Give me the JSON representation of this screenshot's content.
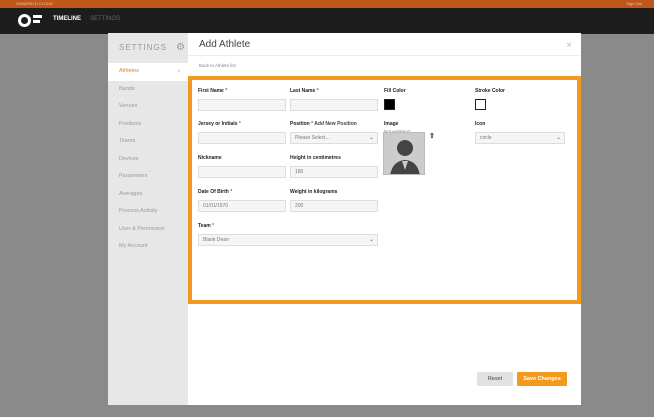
{
  "topbar": {
    "left_text": "OMNIFIELD CLOUD",
    "right_text": "Sign Out"
  },
  "nav": {
    "title": "TIMELINE",
    "second": "SETTINGS"
  },
  "sidebar": {
    "heading": "SETTINGS",
    "items": [
      {
        "label": "Athletes",
        "active": true
      },
      {
        "label": "Bands"
      },
      {
        "label": "Venues"
      },
      {
        "label": "Positions"
      },
      {
        "label": "Teams"
      },
      {
        "label": "Devices"
      },
      {
        "label": "Parameters"
      },
      {
        "label": "Averages"
      },
      {
        "label": "Process Activity"
      },
      {
        "label": "User & Permission"
      },
      {
        "label": "My Account"
      }
    ]
  },
  "dialog": {
    "title": "Add Athlete",
    "close": "×",
    "back_link": "Back to Athlete list"
  },
  "form": {
    "first_name": {
      "label": "First Name",
      "value": ""
    },
    "last_name": {
      "label": "Last Name",
      "value": ""
    },
    "fill_color": {
      "label": "Fill Color",
      "color": "#000000"
    },
    "stroke_color": {
      "label": "Stroke Color",
      "color": "#ffffff"
    },
    "jersey": {
      "label": "Jersey or Initials",
      "value": ""
    },
    "position": {
      "label": "Position",
      "add_link": "Add New Position",
      "value": "Please Select..."
    },
    "image": {
      "label": "Image",
      "note": "Not working?"
    },
    "icon": {
      "label": "Icon",
      "value": "circle"
    },
    "nickname": {
      "label": "Nickname",
      "value": ""
    },
    "height": {
      "label": "Height in centimetres",
      "value": "180"
    },
    "dob": {
      "label": "Date Of Birth",
      "value": "01/01/1970"
    },
    "weight": {
      "label": "Weight in kilograms",
      "value": "200"
    },
    "team": {
      "label": "Team",
      "value": "Blank Dean"
    }
  },
  "buttons": {
    "reset": "Reset",
    "save": "Save Changes"
  },
  "colors": {
    "accent": "#f39a1e",
    "top_strip": "#c0561a",
    "nav_bg": "#1d1d1d",
    "required": "#d43c2b"
  }
}
